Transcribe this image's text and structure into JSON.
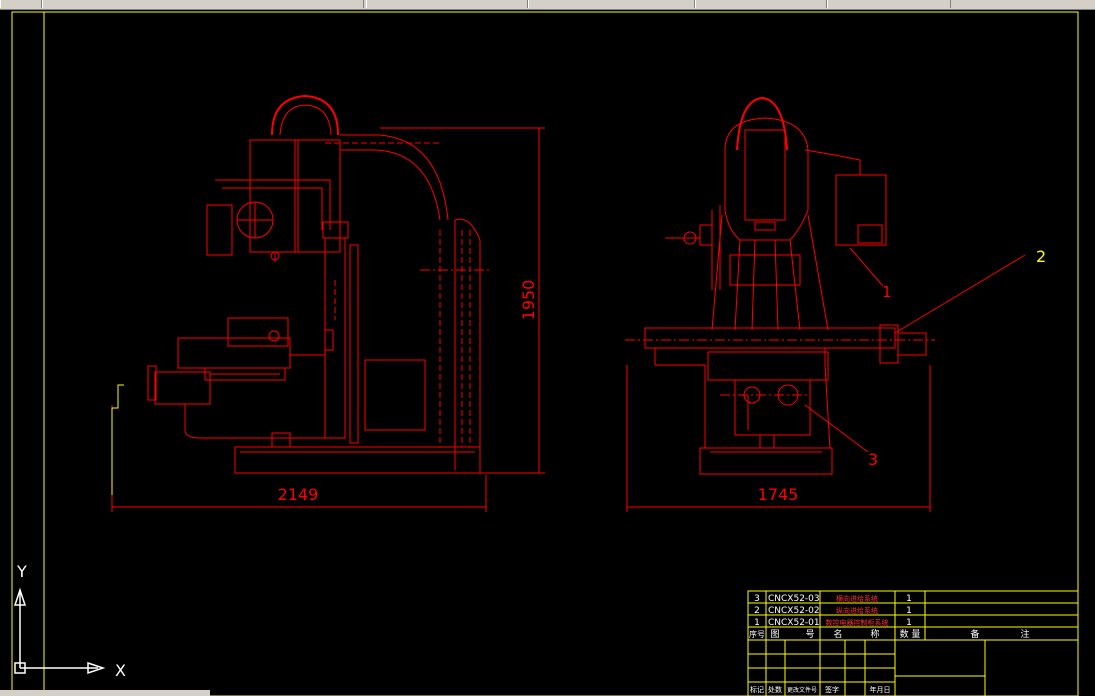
{
  "window": {
    "toolbar_items": [
      "std-toolbar",
      "layer-toolbar",
      "properties-toolbar",
      "linetype-toolbar",
      "lineweight-toolbar"
    ]
  },
  "colors": {
    "background": "#000000",
    "geometry": "#ff0000",
    "dimension": "#ff0000",
    "border": "#ffff00",
    "ucs": "#ffffff",
    "title_text": "#ffffff"
  },
  "dimensions": {
    "side_width": "2149",
    "side_height": "1950",
    "front_width": "1745"
  },
  "callouts": {
    "c1": "1",
    "c2": "2",
    "c3": "3"
  },
  "ucs": {
    "x_label": "X",
    "y_label": "Y"
  },
  "bom": {
    "rows": [
      {
        "no": "3",
        "code": "CNCX52-03",
        "name": "横向进给系统",
        "qty": "1"
      },
      {
        "no": "2",
        "code": "CNCX52-02",
        "name": "纵向进给系统",
        "qty": "1"
      },
      {
        "no": "1",
        "code": "CNCX52-01",
        "name": "数控电器控制柜系统",
        "qty": "1"
      }
    ],
    "header": {
      "no": "序号",
      "code_a": "图",
      "code_b": "号",
      "name_a": "名",
      "name_b": "称",
      "qty": "数 量",
      "remark_a": "备",
      "remark_b": "注"
    },
    "signoff": {
      "mark": "标记",
      "count": "处数",
      "docno": "更改文件号",
      "sign": "签字",
      "date": "年月日"
    }
  }
}
